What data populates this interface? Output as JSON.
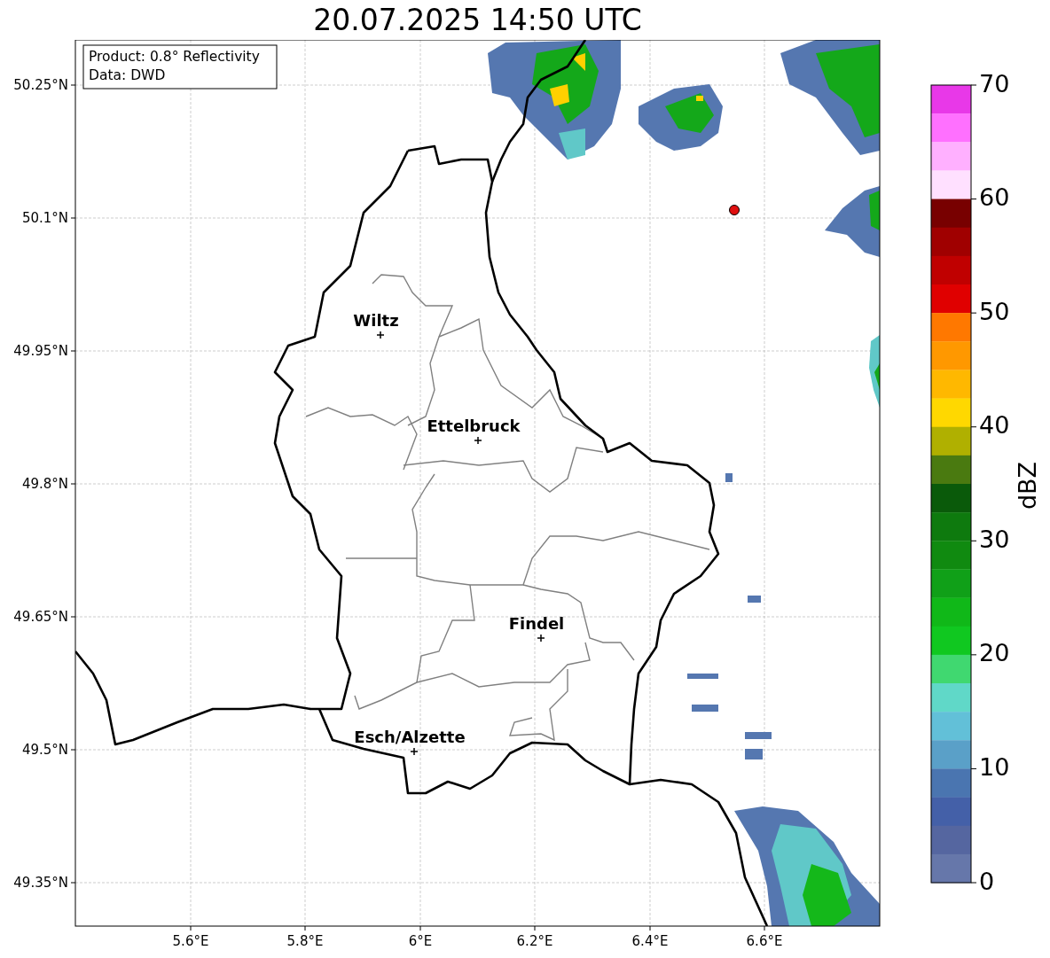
{
  "title": "20.07.2025 14:50 UTC",
  "info_box": {
    "lines": [
      "Product: 0.8° Reflectivity",
      "Data: DWD"
    ]
  },
  "y_axis": {
    "ticks": [
      "50.25°N",
      "50.1°N",
      "49.95°N",
      "49.8°N",
      "49.65°N",
      "49.5°N",
      "49.35°N"
    ]
  },
  "x_axis": {
    "ticks": [
      "5.6°E",
      "5.8°E",
      "6°E",
      "6.2°E",
      "6.4°E",
      "6.6°E"
    ]
  },
  "cities": [
    "Wiltz",
    "Ettelbruck",
    "Findel",
    "Esch/Alzette"
  ],
  "colorbar": {
    "label": "dBZ",
    "ticks": [
      "70",
      "60",
      "50",
      "40",
      "30",
      "20",
      "10",
      "0"
    ],
    "bands": [
      {
        "color": "#e838e8"
      },
      {
        "color": "#ff70ff"
      },
      {
        "color": "#ffb0ff"
      },
      {
        "color": "#ffe0ff"
      },
      {
        "color": "#780000"
      },
      {
        "color": "#a00000"
      },
      {
        "color": "#c00000"
      },
      {
        "color": "#e00000"
      },
      {
        "color": "#ff7800"
      },
      {
        "color": "#ff9800"
      },
      {
        "color": "#ffb800"
      },
      {
        "color": "#ffd800"
      },
      {
        "color": "#b0b000"
      },
      {
        "color": "#4a7a10"
      },
      {
        "color": "#0a5a0a"
      },
      {
        "color": "#0e7a0e"
      },
      {
        "color": "#108a10"
      },
      {
        "color": "#10a018"
      },
      {
        "color": "#10b818"
      },
      {
        "color": "#10c820"
      },
      {
        "color": "#40d870"
      },
      {
        "color": "#60d8c8"
      },
      {
        "color": "#62c0d8"
      },
      {
        "color": "#5aa0c8"
      },
      {
        "color": "#4a75b0"
      },
      {
        "color": "#4460a8"
      },
      {
        "color": "#5566a0"
      },
      {
        "color": "#6677aa"
      }
    ]
  }
}
